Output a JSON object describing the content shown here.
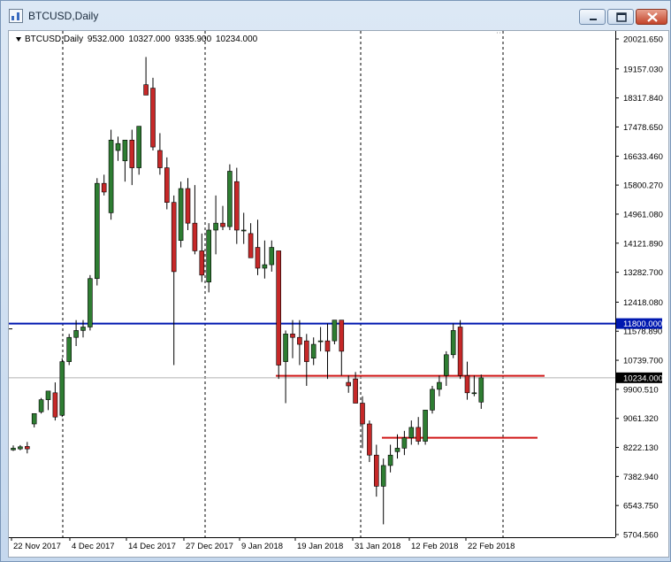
{
  "window": {
    "title": "BTCUSD,Daily",
    "icon": "chart-window-icon",
    "controls": [
      "minimize-icon",
      "maximize-icon",
      "close-icon"
    ]
  },
  "header": {
    "symbol": "BTCUSD,Daily",
    "open": "9532.000",
    "high": "10327.000",
    "low": "9335.900",
    "close": "10234.000"
  },
  "colors": {
    "bull": "#2e7d32",
    "bear": "#c62828",
    "resistance": "#0018b0",
    "support": "#d01818",
    "current": "#000000"
  },
  "chart_data": {
    "type": "candlestick",
    "title": "BTCUSD,Daily",
    "ylim": [
      5500,
      20300
    ],
    "y_ticks": [
      "20021.650",
      "19157.030",
      "18317.840",
      "17478.650",
      "16633.460",
      "15800.270",
      "14961.080",
      "14121.890",
      "13282.700",
      "12418.080",
      "11578.890",
      "10739.700",
      "9900.510",
      "9061.320",
      "8222.130",
      "7382.940",
      "6543.750",
      "5704.560"
    ],
    "x_labels": [
      "22 Nov 2017",
      "4 Dec 2017",
      "14 Dec 2017",
      "27 Dec 2017",
      "9 Jan 2018",
      "19 Jan 2018",
      "31 Jan 2018",
      "12 Feb 2018",
      "22 Feb 2018"
    ],
    "period_separators": [
      "Dec 2017",
      "Jan 2018",
      "Feb 2018",
      "Mar 2018"
    ],
    "horizontal_lines": [
      {
        "label": "11800.000",
        "price": 11800,
        "color": "blue"
      },
      {
        "label": "10234.000",
        "price": 10234,
        "color": "black"
      },
      {
        "label": "",
        "price": 10290,
        "color": "red"
      },
      {
        "label": "",
        "price": 8500,
        "color": "red"
      }
    ],
    "candles": [
      {
        "o": 8150,
        "h": 8280,
        "l": 8120,
        "c": 8200
      },
      {
        "o": 8180,
        "h": 8290,
        "l": 8140,
        "c": 8240
      },
      {
        "o": 8250,
        "h": 8380,
        "l": 8050,
        "c": 8180
      },
      {
        "o": 8900,
        "h": 9100,
        "l": 8800,
        "c": 9200
      },
      {
        "o": 9250,
        "h": 9650,
        "l": 9200,
        "c": 9600
      },
      {
        "o": 9600,
        "h": 9800,
        "l": 9300,
        "c": 9850
      },
      {
        "o": 9800,
        "h": 10100,
        "l": 9000,
        "c": 9100
      },
      {
        "o": 9150,
        "h": 10800,
        "l": 9100,
        "c": 10700
      },
      {
        "o": 10700,
        "h": 11500,
        "l": 10600,
        "c": 11400
      },
      {
        "o": 11400,
        "h": 11900,
        "l": 11150,
        "c": 11600
      },
      {
        "o": 11600,
        "h": 11900,
        "l": 11400,
        "c": 11700
      },
      {
        "o": 11700,
        "h": 13200,
        "l": 11600,
        "c": 13100
      },
      {
        "o": 13100,
        "h": 16000,
        "l": 12900,
        "c": 15850
      },
      {
        "o": 15850,
        "h": 16100,
        "l": 15500,
        "c": 15600
      },
      {
        "o": 15000,
        "h": 17400,
        "l": 14800,
        "c": 17100
      },
      {
        "o": 16800,
        "h": 17200,
        "l": 16500,
        "c": 17000
      },
      {
        "o": 16500,
        "h": 17100,
        "l": 15900,
        "c": 17100
      },
      {
        "o": 17100,
        "h": 17400,
        "l": 15800,
        "c": 16300
      },
      {
        "o": 16300,
        "h": 17500,
        "l": 16100,
        "c": 17500
      },
      {
        "o": 18700,
        "h": 19500,
        "l": 18400,
        "c": 18400
      },
      {
        "o": 18600,
        "h": 18900,
        "l": 16800,
        "c": 16900
      },
      {
        "o": 16800,
        "h": 17300,
        "l": 16100,
        "c": 16300
      },
      {
        "o": 16300,
        "h": 16600,
        "l": 15100,
        "c": 15300
      },
      {
        "o": 15300,
        "h": 15500,
        "l": 10600,
        "c": 13300
      },
      {
        "o": 14200,
        "h": 15900,
        "l": 14000,
        "c": 15700
      },
      {
        "o": 15700,
        "h": 16000,
        "l": 14500,
        "c": 14700
      },
      {
        "o": 14700,
        "h": 15800,
        "l": 13800,
        "c": 13900
      },
      {
        "o": 13900,
        "h": 14400,
        "l": 13000,
        "c": 13200
      },
      {
        "o": 13000,
        "h": 14700,
        "l": 12700,
        "c": 14500
      },
      {
        "o": 14500,
        "h": 15500,
        "l": 13800,
        "c": 14700
      },
      {
        "o": 14700,
        "h": 15200,
        "l": 14500,
        "c": 14600
      },
      {
        "o": 14600,
        "h": 16400,
        "l": 14500,
        "c": 16200
      },
      {
        "o": 15900,
        "h": 16300,
        "l": 14100,
        "c": 14500
      },
      {
        "o": 14500,
        "h": 15000,
        "l": 14100,
        "c": 14500
      },
      {
        "o": 14400,
        "h": 14700,
        "l": 13700,
        "c": 13700
      },
      {
        "o": 14000,
        "h": 14800,
        "l": 13200,
        "c": 13400
      },
      {
        "o": 13400,
        "h": 14200,
        "l": 13100,
        "c": 13500
      },
      {
        "o": 13500,
        "h": 14200,
        "l": 13300,
        "c": 14000
      },
      {
        "o": 13900,
        "h": 13900,
        "l": 10200,
        "c": 10600
      },
      {
        "o": 10700,
        "h": 11600,
        "l": 9500,
        "c": 11500
      },
      {
        "o": 11500,
        "h": 11900,
        "l": 10800,
        "c": 11400
      },
      {
        "o": 11400,
        "h": 11900,
        "l": 10600,
        "c": 11200
      },
      {
        "o": 11300,
        "h": 11500,
        "l": 10000,
        "c": 10700
      },
      {
        "o": 10800,
        "h": 11400,
        "l": 10600,
        "c": 11200
      },
      {
        "o": 11300,
        "h": 11700,
        "l": 11000,
        "c": 11300
      },
      {
        "o": 11300,
        "h": 11800,
        "l": 10200,
        "c": 11000
      },
      {
        "o": 11300,
        "h": 11900,
        "l": 11200,
        "c": 11900
      },
      {
        "o": 11900,
        "h": 11600,
        "l": 10300,
        "c": 11000
      },
      {
        "o": 10100,
        "h": 10300,
        "l": 9800,
        "c": 10000
      },
      {
        "o": 10200,
        "h": 10400,
        "l": 9500,
        "c": 9500
      },
      {
        "o": 9500,
        "h": 9700,
        "l": 8200,
        "c": 8900
      },
      {
        "o": 8900,
        "h": 9000,
        "l": 7800,
        "c": 8000
      },
      {
        "o": 8000,
        "h": 8300,
        "l": 6800,
        "c": 7100
      },
      {
        "o": 7100,
        "h": 7900,
        "l": 6000,
        "c": 7700
      },
      {
        "o": 7700,
        "h": 8300,
        "l": 7500,
        "c": 8000
      },
      {
        "o": 8100,
        "h": 8600,
        "l": 7900,
        "c": 8200
      },
      {
        "o": 8200,
        "h": 8700,
        "l": 8000,
        "c": 8500
      },
      {
        "o": 8500,
        "h": 9000,
        "l": 8300,
        "c": 8800
      },
      {
        "o": 8800,
        "h": 9100,
        "l": 8300,
        "c": 8400
      },
      {
        "o": 8400,
        "h": 9300,
        "l": 8300,
        "c": 9300
      },
      {
        "o": 9300,
        "h": 10000,
        "l": 9200,
        "c": 9900
      },
      {
        "o": 9900,
        "h": 10300,
        "l": 9700,
        "c": 10100
      },
      {
        "o": 10300,
        "h": 11000,
        "l": 10000,
        "c": 10900
      },
      {
        "o": 10900,
        "h": 11800,
        "l": 10800,
        "c": 11600
      },
      {
        "o": 11700,
        "h": 11900,
        "l": 10200,
        "c": 10300
      },
      {
        "o": 10300,
        "h": 10700,
        "l": 9600,
        "c": 9800
      },
      {
        "o": 9800,
        "h": 10300,
        "l": 9700,
        "c": 9800
      },
      {
        "o": 9532,
        "h": 10327,
        "l": 9335.9,
        "c": 10234
      }
    ]
  }
}
